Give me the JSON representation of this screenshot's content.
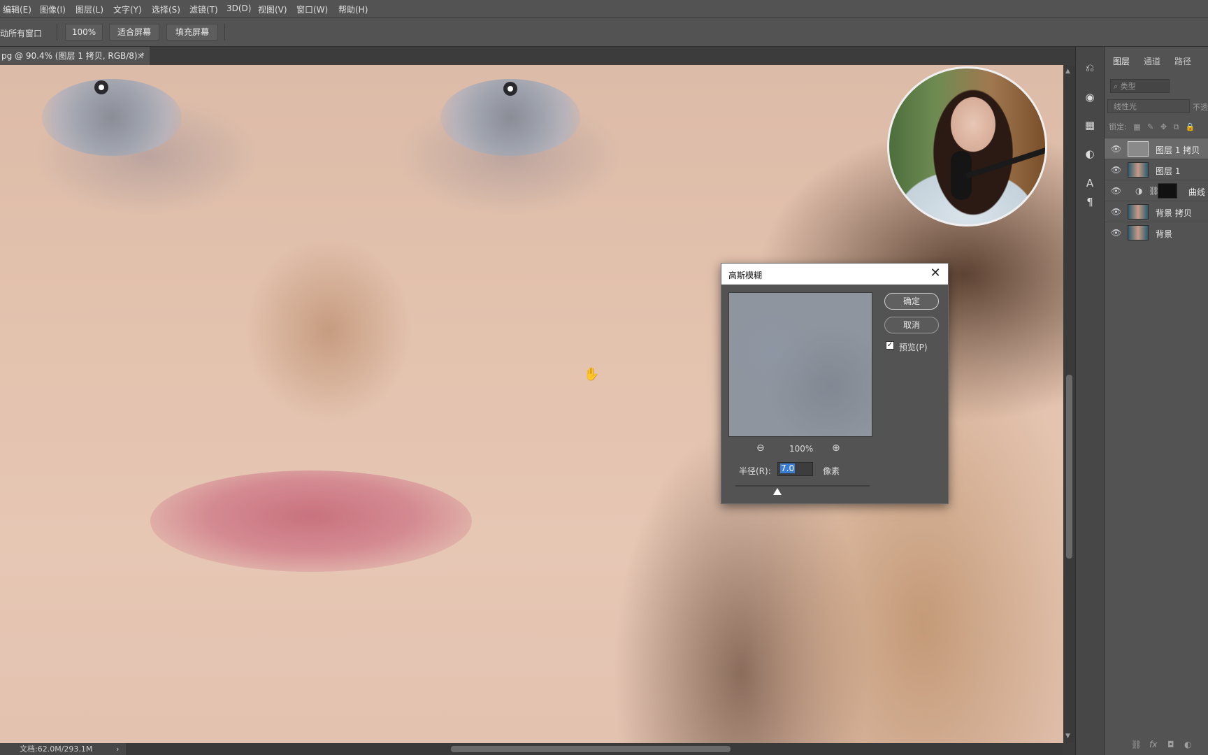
{
  "menu": [
    "编辑(E)",
    "图像(I)",
    "图层(L)",
    "文字(Y)",
    "选择(S)",
    "滤镜(T)",
    "3D(D)",
    "视图(V)",
    "窗口(W)",
    "帮助(H)"
  ],
  "options": {
    "scroll_all_windows": "动所有窗口",
    "zoom_value": "100%",
    "fit_screen": "适合屏幕",
    "fill_screen": "填充屏幕"
  },
  "document_tab": {
    "title": "pg @ 90.4% (图层 1 拷贝, RGB/8) *",
    "close": "×"
  },
  "status": {
    "doc_size": "文档:62.0M/293.1M",
    "arrow": "›"
  },
  "layers_panel": {
    "tabs": [
      "图层",
      "通道",
      "路径"
    ],
    "filter_placeholder": "类型",
    "blend_mode": "线性光",
    "opacity_label": "不透",
    "lock_label": "锁定:",
    "layers": [
      {
        "name": "图层 1 拷贝",
        "selected": true,
        "thumb": "gray"
      },
      {
        "name": "图层 1",
        "selected": false,
        "thumb": "photo"
      },
      {
        "name": "曲线",
        "selected": false,
        "thumb": "adjust"
      },
      {
        "name": "背景 拷贝",
        "selected": false,
        "thumb": "photo"
      },
      {
        "name": "背景",
        "selected": false,
        "thumb": "photo"
      }
    ]
  },
  "dialog": {
    "title": "高斯模糊",
    "ok": "确定",
    "cancel": "取消",
    "preview_label": "预览(P)",
    "preview_checked": true,
    "zoom": "100%",
    "radius_label": "半径(R):",
    "radius_value": "7.0",
    "radius_unit": "像素"
  },
  "colors": {
    "ui_dark": "#535353",
    "selection_blue": "#3a7bd5"
  }
}
